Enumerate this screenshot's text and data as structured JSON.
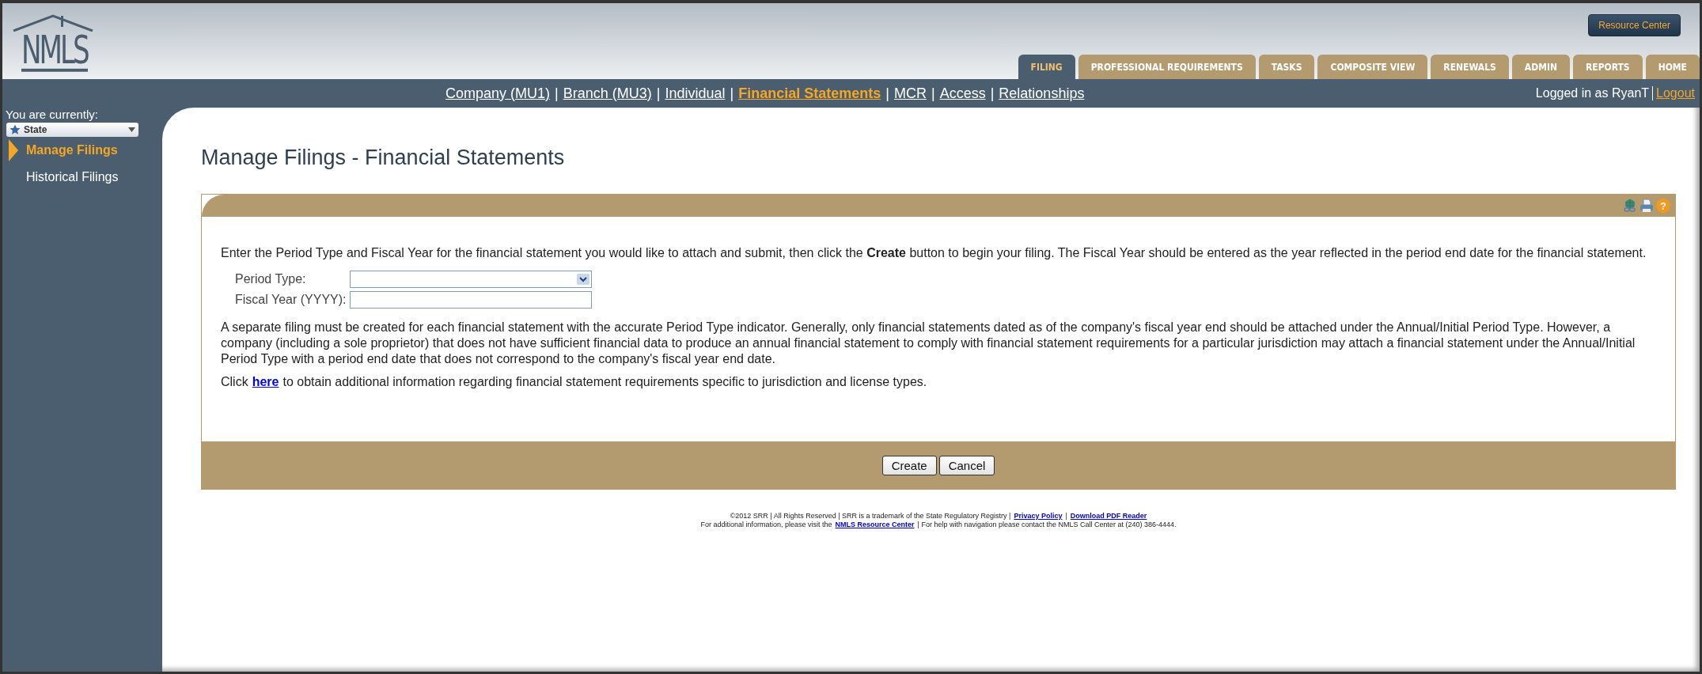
{
  "logo": {
    "text": "NMLS"
  },
  "resource_button": {
    "label": "Resource Center"
  },
  "tabs": [
    {
      "label": "FILING",
      "selected": true
    },
    {
      "label": "PROFESSIONAL REQUIREMENTS",
      "selected": false
    },
    {
      "label": "TASKS",
      "selected": false
    },
    {
      "label": "COMPOSITE VIEW",
      "selected": false
    },
    {
      "label": "RENEWALS",
      "selected": false
    },
    {
      "label": "ADMIN",
      "selected": false
    },
    {
      "label": "REPORTS",
      "selected": false
    },
    {
      "label": "HOME",
      "selected": false
    }
  ],
  "subnav": [
    {
      "label": "Company (MU1)",
      "selected": false
    },
    {
      "label": "Branch (MU3)",
      "selected": false
    },
    {
      "label": "Individual",
      "selected": false
    },
    {
      "label": "Financial Statements",
      "selected": true
    },
    {
      "label": "MCR",
      "selected": false
    },
    {
      "label": "Access",
      "selected": false
    },
    {
      "label": "Relationships",
      "selected": false
    }
  ],
  "subnav_separator": "|",
  "user": {
    "logged_in": "Logged in as RyanT",
    "logout": "Logout"
  },
  "sidebar": {
    "caption": "You are currently:",
    "role": "State",
    "items": [
      {
        "label": "Manage Filings",
        "selected": true
      },
      {
        "label": "Historical Filings",
        "selected": false
      }
    ]
  },
  "page_title": "Manage Filings - Financial Statements",
  "help_glyph": "?",
  "intro": "Enter the Period Type and Fiscal Year for the financial statement you would like to attach and submit, then click the **Create** button to begin your filing. The Fiscal Year should be entered as the year reflected in the period end date for the financial statement.",
  "form": [
    {
      "kind": "select",
      "label": "Period Type:"
    },
    {
      "kind": "text",
      "label": "Fiscal Year (YYYY):"
    }
  ],
  "note": "A separate filing must be created for each financial statement with the accurate Period Type indicator. Generally, only financial statements dated as of the company's fiscal year end should be attached under the Annual/Initial Period Type. However, a company (including a sole proprietor) that does not have sufficient financial data to produce an annual financial statement to comply with financial statement requirements for a particular jurisdiction may attach a financial statement under the Annual/Initial Period Type with a period end date that does not correspond to the company's fiscal year end date.",
  "click_line": {
    "before": "Click",
    "link": "here",
    "after": "to obtain additional information regarding financial statement requirements specific to jurisdiction and license types."
  },
  "buttons": [
    "Create",
    "Cancel"
  ],
  "footer": [
    [
      {
        "kind": "text",
        "text": "©2012 SRR | All Rights Reserved | SRR is a trademark of the State Regulatory Registry |"
      },
      {
        "kind": "link",
        "text": "Privacy Policy"
      },
      {
        "kind": "text",
        "text": "|"
      },
      {
        "kind": "link",
        "text": "Download PDF Reader"
      }
    ],
    [
      {
        "kind": "text",
        "text": "For additional information, please visit the"
      },
      {
        "kind": "link",
        "text": "NMLS Resource Center"
      },
      {
        "kind": "text",
        "text": "| For help with navigation please contact the NMLS Call Center at (240) 386-4444."
      }
    ]
  ]
}
